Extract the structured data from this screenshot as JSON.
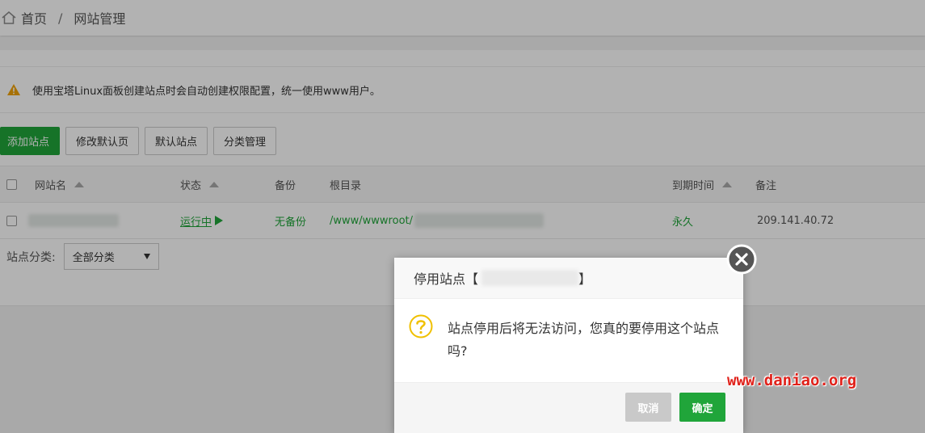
{
  "breadcrumb": {
    "home": "首页",
    "separator": "/",
    "current": "网站管理"
  },
  "notice": {
    "text": "使用宝塔Linux面板创建站点时会自动创建权限配置，统一使用www用户。"
  },
  "toolbar": {
    "add_site": "添加站点",
    "modify_default_page": "修改默认页",
    "default_site": "默认站点",
    "category_manage": "分类管理"
  },
  "table": {
    "headers": {
      "name": "网站名",
      "status": "状态",
      "backup": "备份",
      "root": "根目录",
      "expire": "到期时间",
      "note": "备注"
    },
    "rows": [
      {
        "status": "运行中",
        "backup": "无备份",
        "root": "/www/wwwroot/",
        "expire": "永久",
        "note": "209.141.40.72"
      }
    ]
  },
  "category": {
    "label": "站点分类:",
    "selected": "全部分类"
  },
  "dialog": {
    "title": "停用站点【",
    "title_end": "】",
    "message": "站点停用后将无法访问，您真的要停用这个站点吗?",
    "cancel": "取消",
    "confirm": "确定"
  },
  "watermark": "www.daniao.org",
  "colors": {
    "accent": "#20a53a",
    "warning": "#f0a30a",
    "watermark": "#e0221b"
  }
}
